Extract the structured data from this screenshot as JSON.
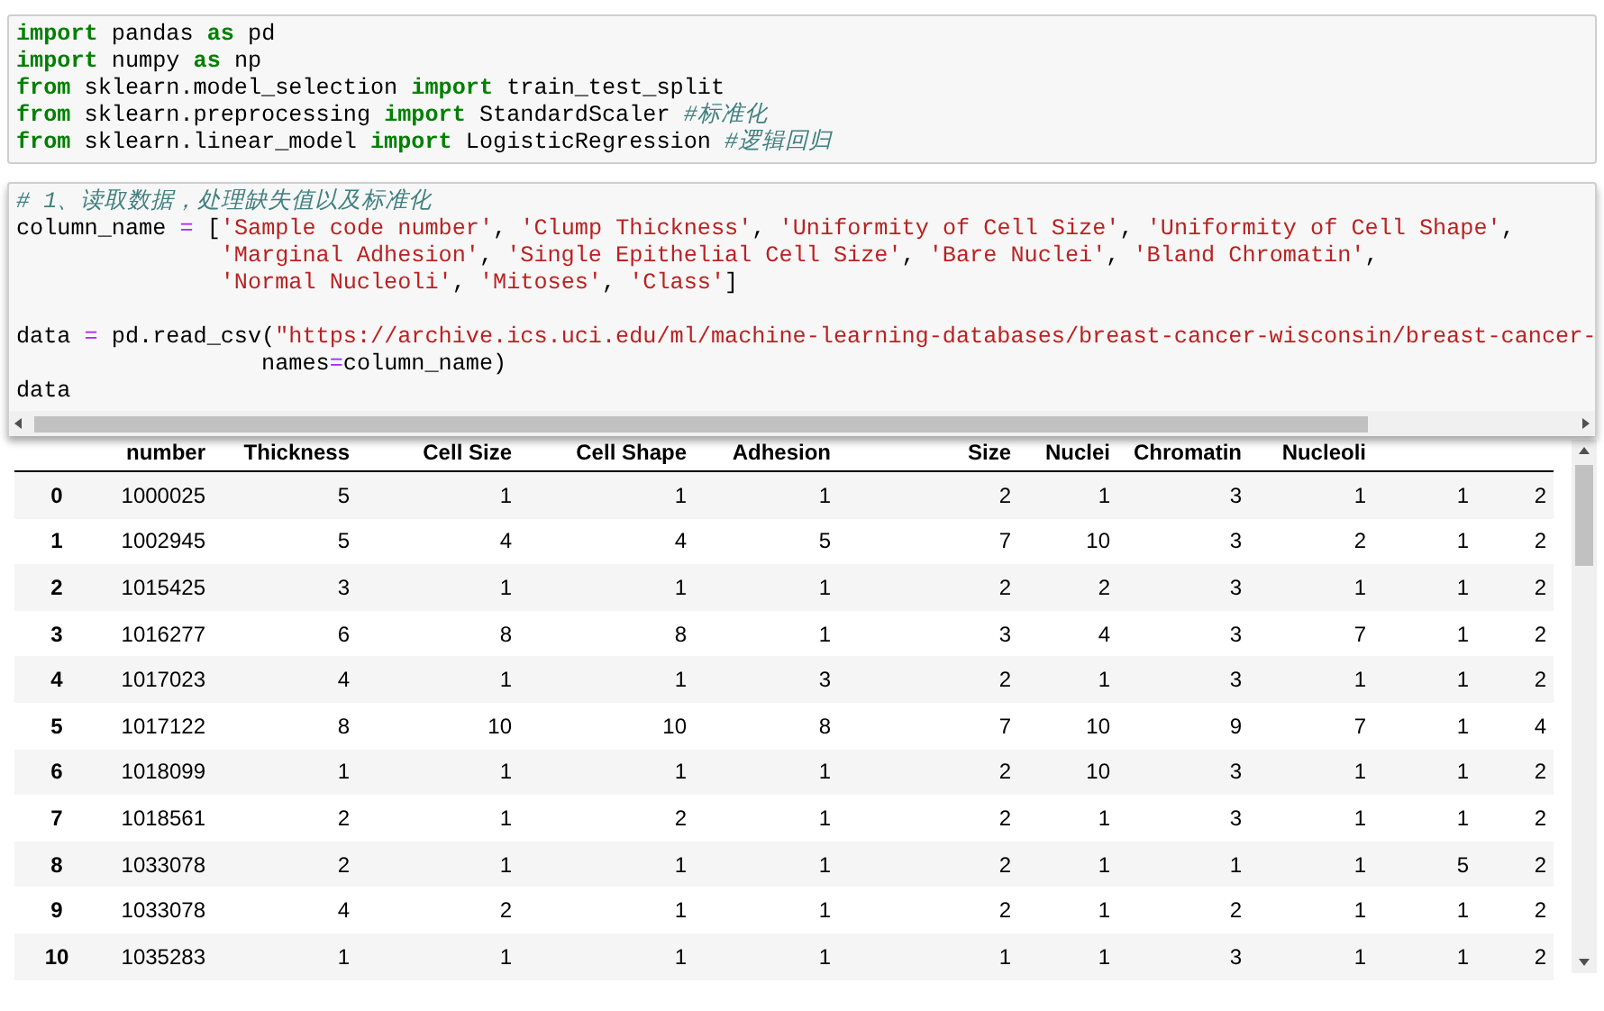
{
  "cells": [
    {
      "lines": [
        {
          "tokens": [
            {
              "kind": "kw",
              "text": "import"
            },
            {
              "kind": "plain",
              "text": " pandas "
            },
            {
              "kind": "kw",
              "text": "as"
            },
            {
              "kind": "plain",
              "text": " pd"
            }
          ]
        },
        {
          "tokens": [
            {
              "kind": "kw",
              "text": "import"
            },
            {
              "kind": "plain",
              "text": " numpy "
            },
            {
              "kind": "kw",
              "text": "as"
            },
            {
              "kind": "plain",
              "text": " np"
            }
          ]
        },
        {
          "tokens": [
            {
              "kind": "kw",
              "text": "from"
            },
            {
              "kind": "plain",
              "text": " sklearn.model_selection "
            },
            {
              "kind": "kw",
              "text": "import"
            },
            {
              "kind": "plain",
              "text": " train_test_split"
            }
          ]
        },
        {
          "tokens": [
            {
              "kind": "kw",
              "text": "from"
            },
            {
              "kind": "plain",
              "text": " sklearn.preprocessing "
            },
            {
              "kind": "kw",
              "text": "import"
            },
            {
              "kind": "plain",
              "text": " StandardScaler "
            },
            {
              "kind": "comment",
              "text": "#标准化"
            }
          ]
        },
        {
          "tokens": [
            {
              "kind": "kw",
              "text": "from"
            },
            {
              "kind": "plain",
              "text": " sklearn.linear_model "
            },
            {
              "kind": "kw",
              "text": "import"
            },
            {
              "kind": "plain",
              "text": " LogisticRegression "
            },
            {
              "kind": "comment",
              "text": "#逻辑回归"
            }
          ]
        }
      ]
    },
    {
      "scrollbar": true,
      "lines": [
        {
          "tokens": [
            {
              "kind": "comment",
              "text": "# 1、读取数据，处理缺失值以及标准化"
            }
          ]
        },
        {
          "tokens": [
            {
              "kind": "plain",
              "text": "column_name "
            },
            {
              "kind": "op",
              "text": "="
            },
            {
              "kind": "plain",
              "text": " ["
            },
            {
              "kind": "str",
              "text": "'Sample code number'"
            },
            {
              "kind": "plain",
              "text": ", "
            },
            {
              "kind": "str",
              "text": "'Clump Thickness'"
            },
            {
              "kind": "plain",
              "text": ", "
            },
            {
              "kind": "str",
              "text": "'Uniformity of Cell Size'"
            },
            {
              "kind": "plain",
              "text": ", "
            },
            {
              "kind": "str",
              "text": "'Uniformity of Cell Shape'"
            },
            {
              "kind": "plain",
              "text": ","
            }
          ]
        },
        {
          "kind": "list_cont",
          "tokens": [
            {
              "kind": "str",
              "text": "'Marginal Adhesion'"
            },
            {
              "kind": "plain",
              "text": ", "
            },
            {
              "kind": "str",
              "text": "'Single Epithelial Cell Size'"
            },
            {
              "kind": "plain",
              "text": ", "
            },
            {
              "kind": "str",
              "text": "'Bare Nuclei'"
            },
            {
              "kind": "plain",
              "text": ", "
            },
            {
              "kind": "str",
              "text": "'Bland Chromatin'"
            },
            {
              "kind": "plain",
              "text": ","
            }
          ]
        },
        {
          "kind": "list_cont",
          "tokens": [
            {
              "kind": "str",
              "text": "'Normal Nucleoli'"
            },
            {
              "kind": "plain",
              "text": ", "
            },
            {
              "kind": "str",
              "text": "'Mitoses'"
            },
            {
              "kind": "plain",
              "text": ", "
            },
            {
              "kind": "str",
              "text": "'Class'"
            },
            {
              "kind": "plain",
              "text": "]"
            }
          ]
        },
        {
          "gap_before": true,
          "tokens": [
            {
              "kind": "plain",
              "text": "data "
            },
            {
              "kind": "op",
              "text": "="
            },
            {
              "kind": "plain",
              "text": " pd.read_csv("
            },
            {
              "kind": "str",
              "text": "\"https://archive.ics.uci.edu/ml/machine-learning-databases/breast-cancer-wisconsin/breast-cancer-"
            }
          ]
        },
        {
          "kind": "arg_cont",
          "tokens": [
            {
              "kind": "plain",
              "text": "names"
            },
            {
              "kind": "op",
              "text": "="
            },
            {
              "kind": "plain",
              "text": "column_name)"
            }
          ]
        },
        {
          "tokens": [
            {
              "kind": "plain",
              "text": "data"
            }
          ]
        }
      ]
    }
  ],
  "table": {
    "columns": [
      null,
      "number",
      "Thickness",
      "Cell Size",
      "Cell Shape",
      "Adhesion",
      "Size",
      "Nuclei",
      "Chromatin",
      "Nucleoli",
      null,
      null
    ],
    "rows": [
      [
        "0",
        "1000025",
        "5",
        "1",
        "1",
        "1",
        "2",
        "1",
        "3",
        "1",
        "1",
        "2"
      ],
      [
        "1",
        "1002945",
        "5",
        "4",
        "4",
        "5",
        "7",
        "10",
        "3",
        "2",
        "1",
        "2"
      ],
      [
        "2",
        "1015425",
        "3",
        "1",
        "1",
        "1",
        "2",
        "2",
        "3",
        "1",
        "1",
        "2"
      ],
      [
        "3",
        "1016277",
        "6",
        "8",
        "8",
        "1",
        "3",
        "4",
        "3",
        "7",
        "1",
        "2"
      ],
      [
        "4",
        "1017023",
        "4",
        "1",
        "1",
        "3",
        "2",
        "1",
        "3",
        "1",
        "1",
        "2"
      ],
      [
        "5",
        "1017122",
        "8",
        "10",
        "10",
        "8",
        "7",
        "10",
        "9",
        "7",
        "1",
        "4"
      ],
      [
        "6",
        "1018099",
        "1",
        "1",
        "1",
        "1",
        "2",
        "10",
        "3",
        "1",
        "1",
        "2"
      ],
      [
        "7",
        "1018561",
        "2",
        "1",
        "2",
        "1",
        "2",
        "1",
        "3",
        "1",
        "1",
        "2"
      ],
      [
        "8",
        "1033078",
        "2",
        "1",
        "1",
        "1",
        "2",
        "1",
        "1",
        "1",
        "5",
        "2"
      ],
      [
        "9",
        "1033078",
        "4",
        "2",
        "1",
        "1",
        "2",
        "1",
        "2",
        "1",
        "1",
        "2"
      ],
      [
        "10",
        "1035283",
        "1",
        "1",
        "1",
        "1",
        "1",
        "1",
        "3",
        "1",
        "1",
        "2"
      ]
    ]
  }
}
